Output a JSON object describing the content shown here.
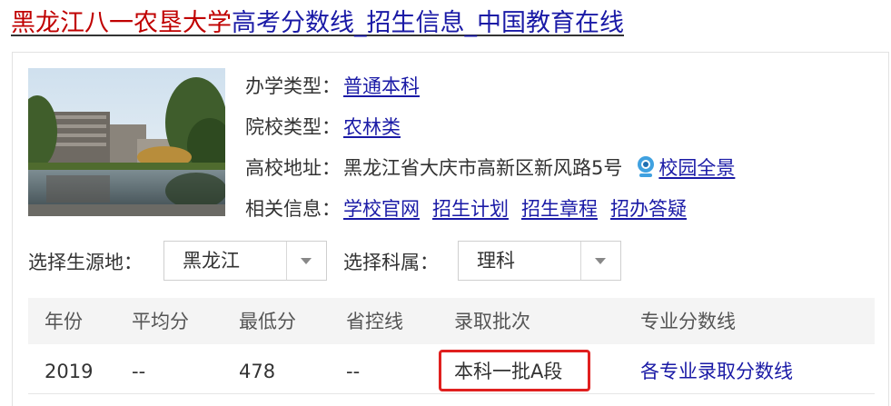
{
  "title": {
    "school": "黑龙江八一农垦大学",
    "rest": "高考分数线_招生信息_中国教育在线"
  },
  "info": {
    "school_type_label": "办学类型：",
    "school_type_value": "普通本科",
    "category_label": "院校类型：",
    "category_value": "农林类",
    "address_label": "高校地址：",
    "address_value": "黑龙江省大庆市高新区新风路5号",
    "campus_view_label": "校园全景",
    "related_label": "相关信息：",
    "related_links": [
      "学校官网",
      "招生计划",
      "招生章程",
      "招办答疑"
    ]
  },
  "filters": {
    "origin_label": "选择生源地：",
    "origin_value": "黑龙江",
    "subject_label": "选择科属：",
    "subject_value": "理科"
  },
  "table": {
    "headers": [
      "年份",
      "平均分",
      "最低分",
      "省控线",
      "录取批次",
      "专业分数线"
    ],
    "rows": [
      {
        "year": "2019",
        "average": "--",
        "minimum": "478",
        "control_line": "--",
        "batch": "本科一批A段",
        "major_link": "各专业录取分数线"
      }
    ]
  },
  "colors": {
    "school_red": "#c00000",
    "link_blue": "#1a1aa6",
    "highlight_red": "#e0201f",
    "header_bg": "#f4f4f4"
  },
  "icons": {
    "campus_view": "camera-icon",
    "select_caret": "chevron-down-icon"
  }
}
